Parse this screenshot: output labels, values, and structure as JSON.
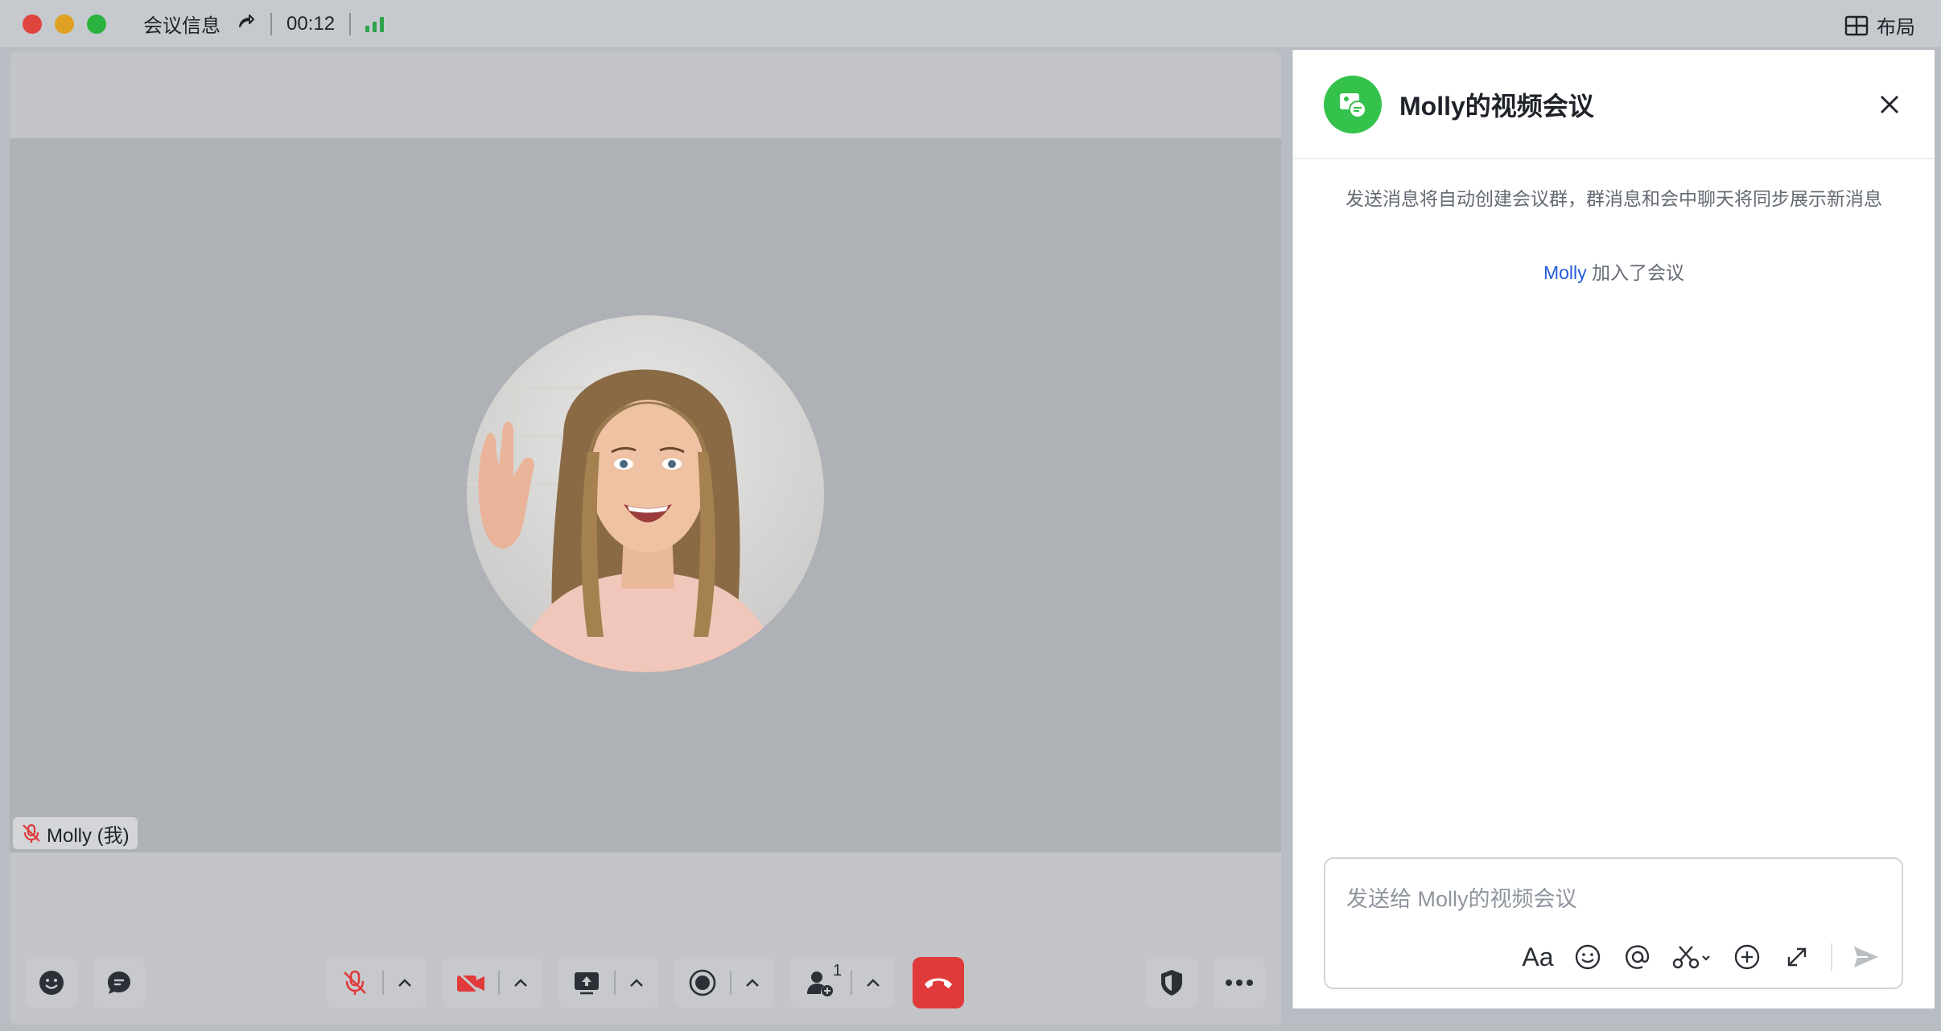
{
  "titlebar": {
    "meeting_info": "会议信息",
    "timer": "00:12",
    "layout_label": "布局"
  },
  "video": {
    "participant_name": "Molly (我)"
  },
  "toolbar": {
    "participant_count": "1"
  },
  "chat": {
    "title": "Molly的视频会议",
    "note": "发送消息将自动创建会议群，群消息和会中聊天将同步展示新消息",
    "join_user": "Molly",
    "join_text": "加入了会议",
    "input_placeholder": "发送给 Molly的视频会议",
    "format_label": "Aa"
  },
  "colors": {
    "accent_green": "#34c24c",
    "hangup_red": "#e03a3a",
    "link_blue": "#245bdb",
    "mute_red": "#e03a3a"
  }
}
